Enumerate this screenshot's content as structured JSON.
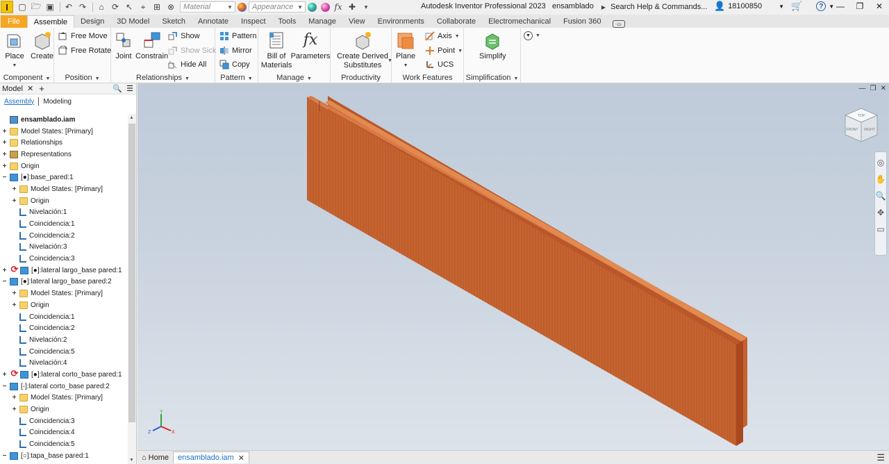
{
  "app": {
    "logo_letter": "I",
    "title": "Autodesk Inventor Professional 2023",
    "document": "ensamblado",
    "search_placeholder": "Search Help & Commands...",
    "user_id": "18100850",
    "material_placeholder": "Material",
    "appearance_placeholder": "Appearance"
  },
  "tabs": [
    "File",
    "Assemble",
    "Design",
    "3D Model",
    "Sketch",
    "Annotate",
    "Inspect",
    "Tools",
    "Manage",
    "View",
    "Environments",
    "Collaborate",
    "Electromechanical",
    "Fusion 360"
  ],
  "active_tab": "Assemble",
  "ribbon": {
    "component": {
      "title": "Component",
      "place": "Place",
      "create": "Create"
    },
    "position": {
      "title": "Position",
      "free_move": "Free Move",
      "free_rotate": "Free Rotate"
    },
    "relationships": {
      "title": "Relationships",
      "joint": "Joint",
      "constrain": "Constrain",
      "show": "Show",
      "show_sick": "Show Sick",
      "hide_all": "Hide All"
    },
    "pattern": {
      "title": "Pattern",
      "pattern": "Pattern",
      "mirror": "Mirror",
      "copy": "Copy"
    },
    "manage": {
      "title": "Manage",
      "bom": "Bill of Materials",
      "parameters": "Parameters",
      "fx": "fx"
    },
    "productivity": {
      "title": "Productivity",
      "derived": "Create Derived Substitutes"
    },
    "work_features": {
      "title": "Work Features",
      "plane": "Plane",
      "axis": "Axis",
      "point": "Point",
      "ucs": "UCS"
    },
    "simplification": {
      "title": "Simplification",
      "simplify": "Simplify"
    }
  },
  "browser": {
    "tab": "Model",
    "modes": [
      "Assembly",
      "Modeling"
    ],
    "tree": [
      {
        "label": "ensamblado.iam",
        "level": 0,
        "icon": "root",
        "exp": "",
        "bold": true
      },
      {
        "label": "Model States: [Primary]",
        "level": 0,
        "icon": "folder",
        "exp": "+"
      },
      {
        "label": "Relationships",
        "level": 0,
        "icon": "folder",
        "exp": "+"
      },
      {
        "label": "Representations",
        "level": 0,
        "icon": "rep",
        "exp": "+"
      },
      {
        "label": "Origin",
        "level": 0,
        "icon": "folder",
        "exp": "+"
      },
      {
        "label": "[●]:base_pared:1",
        "level": 0,
        "icon": "part",
        "exp": "−"
      },
      {
        "label": "Model States: [Primary]",
        "level": 1,
        "icon": "folder",
        "exp": "+"
      },
      {
        "label": "Origin",
        "level": 1,
        "icon": "folder",
        "exp": "+"
      },
      {
        "label": "Nivelación:1",
        "level": 1,
        "icon": "constraint",
        "exp": ""
      },
      {
        "label": "Coincidencia:1",
        "level": 1,
        "icon": "constraint",
        "exp": ""
      },
      {
        "label": "Coincidencia:2",
        "level": 1,
        "icon": "constraint",
        "exp": ""
      },
      {
        "label": "Nivelación:3",
        "level": 1,
        "icon": "constraint",
        "exp": ""
      },
      {
        "label": "Coincidencia:3",
        "level": 1,
        "icon": "constraint",
        "exp": ""
      },
      {
        "label": "[●]:lateral largo_base pared:1",
        "level": 0,
        "icon": "part",
        "exp": "+",
        "refresh": true
      },
      {
        "label": "[●]:lateral largo_base pared:2",
        "level": 0,
        "icon": "part",
        "exp": "−"
      },
      {
        "label": "Model States: [Primary]",
        "level": 1,
        "icon": "folder",
        "exp": "+"
      },
      {
        "label": "Origin",
        "level": 1,
        "icon": "folder",
        "exp": "+"
      },
      {
        "label": "Coincidencia:1",
        "level": 1,
        "icon": "constraint",
        "exp": ""
      },
      {
        "label": "Coincidencia:2",
        "level": 1,
        "icon": "constraint",
        "exp": ""
      },
      {
        "label": "Nivelación:2",
        "level": 1,
        "icon": "constraint",
        "exp": ""
      },
      {
        "label": "Coincidencia:5",
        "level": 1,
        "icon": "constraint",
        "exp": ""
      },
      {
        "label": "Nivelación:4",
        "level": 1,
        "icon": "constraint",
        "exp": ""
      },
      {
        "label": "[●]:lateral corto_base pared:1",
        "level": 0,
        "icon": "part",
        "exp": "+",
        "refresh": true
      },
      {
        "label": "[-]:lateral corto_base pared:2",
        "level": 0,
        "icon": "part",
        "exp": "−"
      },
      {
        "label": "Model States: [Primary]",
        "level": 1,
        "icon": "folder",
        "exp": "+"
      },
      {
        "label": "Origin",
        "level": 1,
        "icon": "folder",
        "exp": "+"
      },
      {
        "label": "Coincidencia:3",
        "level": 1,
        "icon": "constraint",
        "exp": ""
      },
      {
        "label": "Coincidencia:4",
        "level": 1,
        "icon": "constraint",
        "exp": ""
      },
      {
        "label": "Coincidencia:5",
        "level": 1,
        "icon": "constraint",
        "exp": ""
      },
      {
        "label": "[○]:tapa_base pared:1",
        "level": 0,
        "icon": "part",
        "exp": "−"
      }
    ]
  },
  "viewcube": {
    "top": "TOP",
    "front": "FRONT",
    "right": "RIGHT"
  },
  "triad": {
    "x": "X",
    "y": "Y",
    "z": "Z"
  },
  "doc_tabs": {
    "home": "Home",
    "active": "ensamblado.iam"
  },
  "colors": {
    "accent": "#1a6fc4",
    "file_tab": "#f5a623",
    "part_face": "#c4622e"
  }
}
